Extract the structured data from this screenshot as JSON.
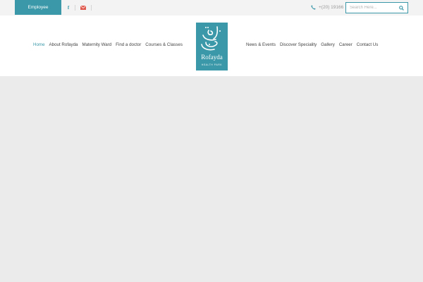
{
  "topbar": {
    "employee_label": "Employee",
    "social": [
      "facebook-icon",
      "mail-icon"
    ],
    "phone": "+(20) 19166",
    "search_placeholder": "Search Here..."
  },
  "nav": {
    "left": [
      "Home",
      "About Rofayda",
      "Maternity Ward",
      "Find a doctor",
      "Courses & Classes"
    ],
    "right": [
      "News & Events",
      "Discover Speciality",
      "Gallery",
      "Career",
      "Contact Us"
    ],
    "active": "Home"
  },
  "logo": {
    "name": "Rofayda",
    "tagline": "HEALTH PARK"
  },
  "colors": {
    "accent": "#3a98a8",
    "header_bg": "#ffffff",
    "topbar_bg": "#f3f3f3",
    "content_bg": "#ebebeb",
    "mail_red": "#e05a4f"
  }
}
